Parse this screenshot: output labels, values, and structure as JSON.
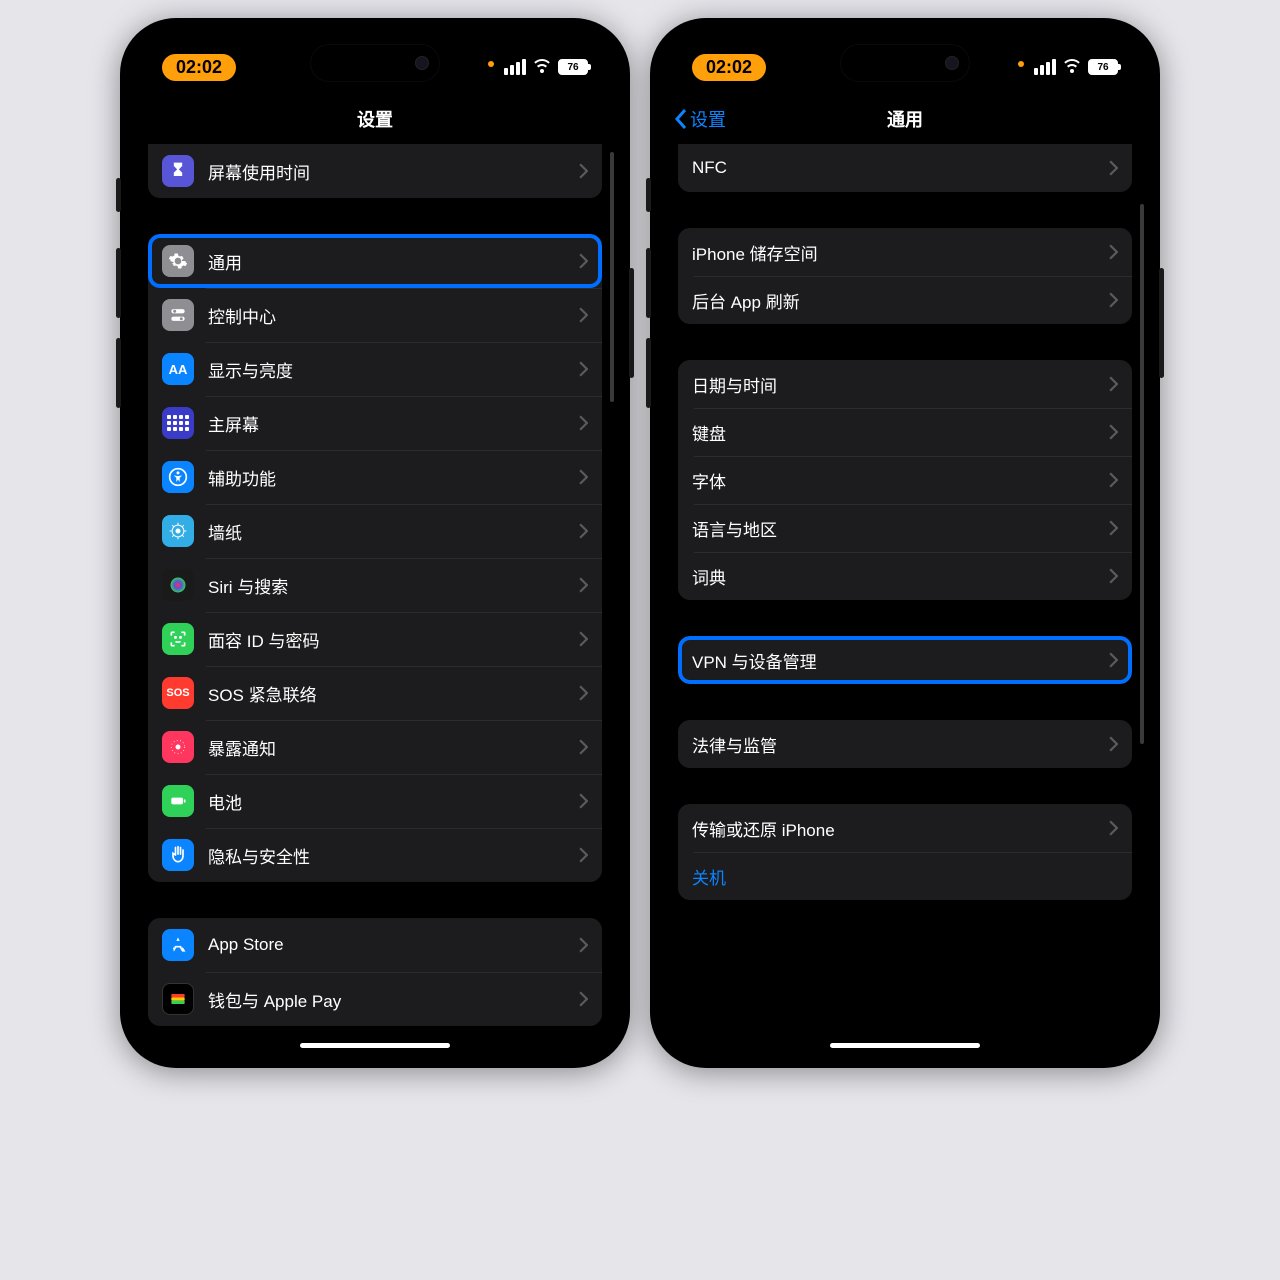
{
  "status": {
    "time": "02:02",
    "battery": "76"
  },
  "left": {
    "title": "设置",
    "items": {
      "screentime": "屏幕使用时间",
      "general": "通用",
      "control": "控制中心",
      "display": "显示与亮度",
      "home": "主屏幕",
      "accessibility": "辅助功能",
      "wallpaper": "墙纸",
      "siri": "Siri 与搜索",
      "faceid": "面容 ID 与密码",
      "sos": "SOS 紧急联络",
      "exposure": "暴露通知",
      "battery": "电池",
      "privacy": "隐私与安全性",
      "appstore": "App Store",
      "wallet": "钱包与 Apple Pay"
    }
  },
  "right": {
    "back": "设置",
    "title": "通用",
    "items": {
      "nfc": "NFC",
      "storage": "iPhone 储存空间",
      "bgrefresh": "后台 App 刷新",
      "datetime": "日期与时间",
      "keyboard": "键盘",
      "fonts": "字体",
      "language": "语言与地区",
      "dictionary": "词典",
      "vpn": "VPN 与设备管理",
      "legal": "法律与监管",
      "transfer": "传输或还原 iPhone",
      "shutdown": "关机"
    }
  }
}
